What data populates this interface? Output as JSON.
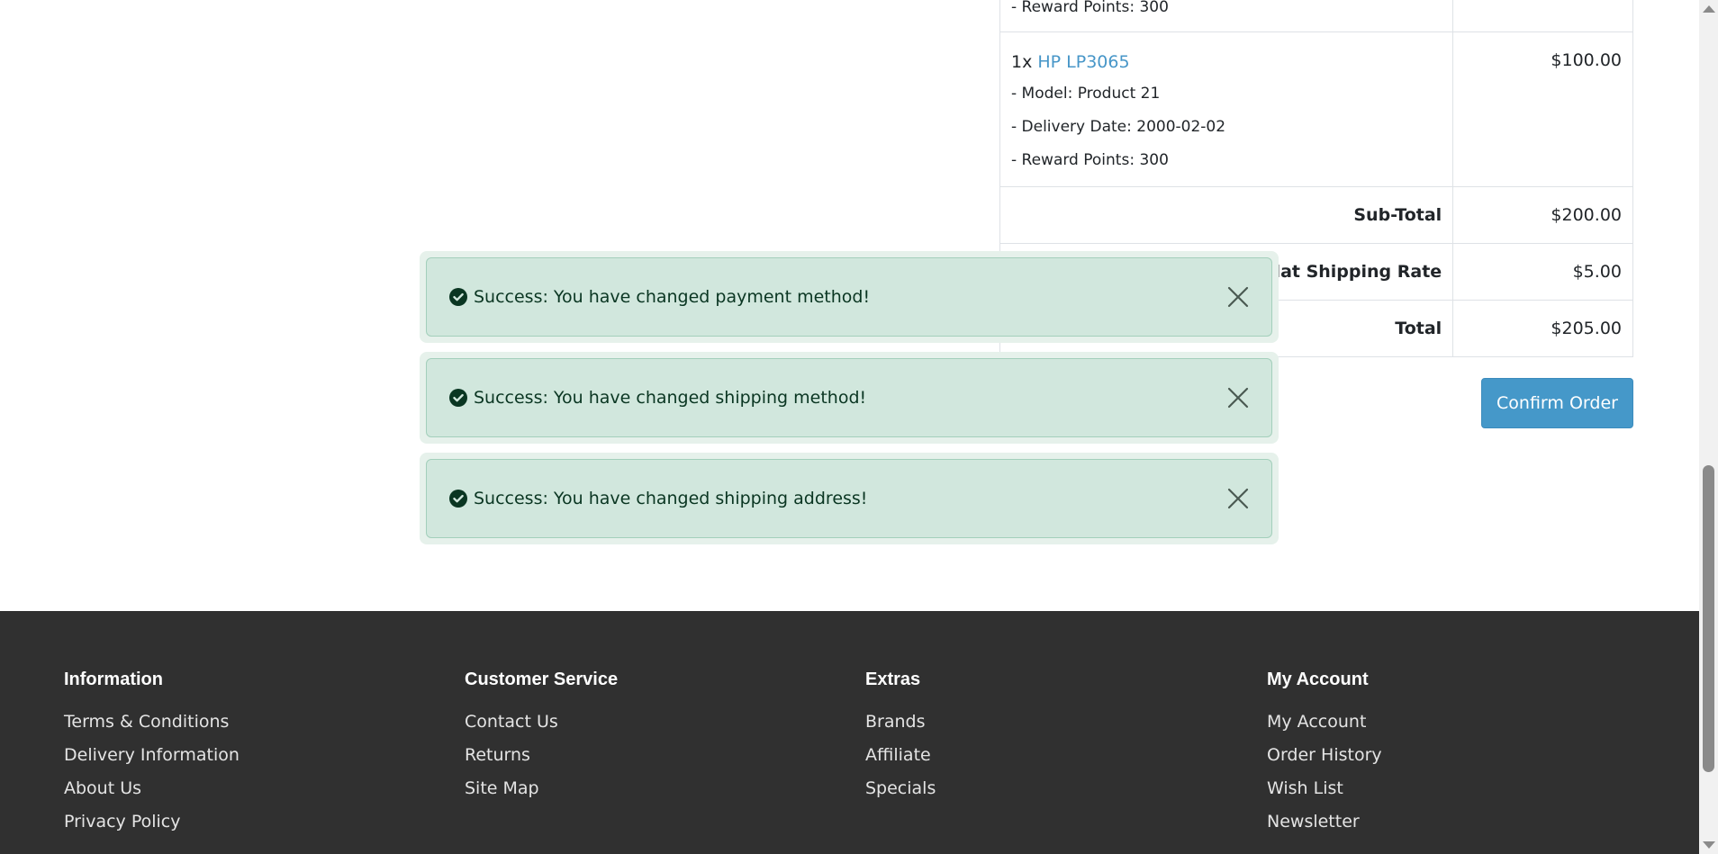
{
  "order": {
    "partial_row": {
      "reward": "- Reward Points: 300"
    },
    "product": {
      "qty": "1x",
      "name": "HP LP3065",
      "model": "- Model: Product 21",
      "delivery": "- Delivery Date: 2000-02-02",
      "reward": "- Reward Points: 300",
      "price": "$100.00"
    },
    "totals": [
      {
        "label": "Sub-Total",
        "value": "$200.00"
      },
      {
        "label": "Flat Shipping Rate",
        "value": "$5.00"
      },
      {
        "label": "Total",
        "value": "$205.00"
      }
    ],
    "confirm_label": "Confirm Order"
  },
  "alerts": [
    {
      "text": "Success: You have changed payment method!",
      "icon": "check-circle-icon"
    },
    {
      "text": "Success: You have changed shipping method!",
      "icon": "check-circle-icon"
    },
    {
      "text": "Success: You have changed shipping address!",
      "icon": "check-circle-icon"
    }
  ],
  "footer": {
    "columns": [
      {
        "title": "Information",
        "links": [
          "Terms & Conditions",
          "Delivery Information",
          "About Us",
          "Privacy Policy"
        ]
      },
      {
        "title": "Customer Service",
        "links": [
          "Contact Us",
          "Returns",
          "Site Map"
        ]
      },
      {
        "title": "Extras",
        "links": [
          "Brands",
          "Affiliate",
          "Specials"
        ]
      },
      {
        "title": "My Account",
        "links": [
          "My Account",
          "Order History",
          "Wish List",
          "Newsletter"
        ]
      }
    ]
  },
  "colors": {
    "alert_bg": "#d1e7dd",
    "alert_text": "#0a3622",
    "link": "#4796c8",
    "button": "#4598c9",
    "footer_bg": "#303030"
  }
}
